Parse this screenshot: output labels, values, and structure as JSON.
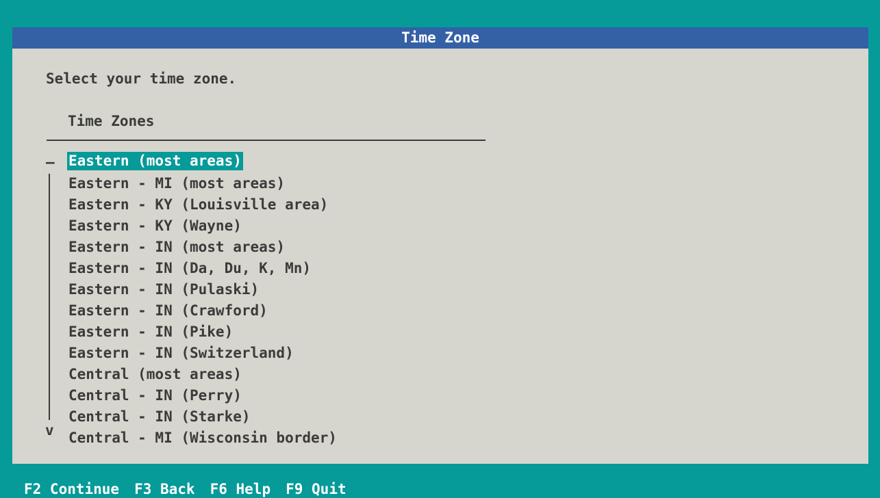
{
  "window": {
    "title": "Time Zone",
    "prompt": "Select your time zone."
  },
  "list": {
    "header": "Time Zones",
    "scroll_up_indicator": "—",
    "scroll_down_indicator": "v",
    "selected_index": 0,
    "items": [
      "Eastern (most areas)",
      "Eastern - MI (most areas)",
      "Eastern - KY (Louisville area)",
      "Eastern - KY (Wayne)",
      "Eastern - IN (most areas)",
      "Eastern - IN (Da, Du, K, Mn)",
      "Eastern - IN (Pulaski)",
      "Eastern - IN (Crawford)",
      "Eastern - IN (Pike)",
      "Eastern - IN (Switzerland)",
      "Central (most areas)",
      "Central - IN (Perry)",
      "Central - IN (Starke)",
      "Central - MI (Wisconsin border)"
    ]
  },
  "footer": {
    "keys": [
      "F2 Continue",
      "F3 Back",
      "F6 Help",
      "F9 Quit"
    ]
  },
  "colors": {
    "background": "#069a99",
    "panel": "#d6d6ce",
    "title_bar": "#3461a6",
    "selected_bg": "#069a99",
    "text": "#3b3b3b"
  }
}
